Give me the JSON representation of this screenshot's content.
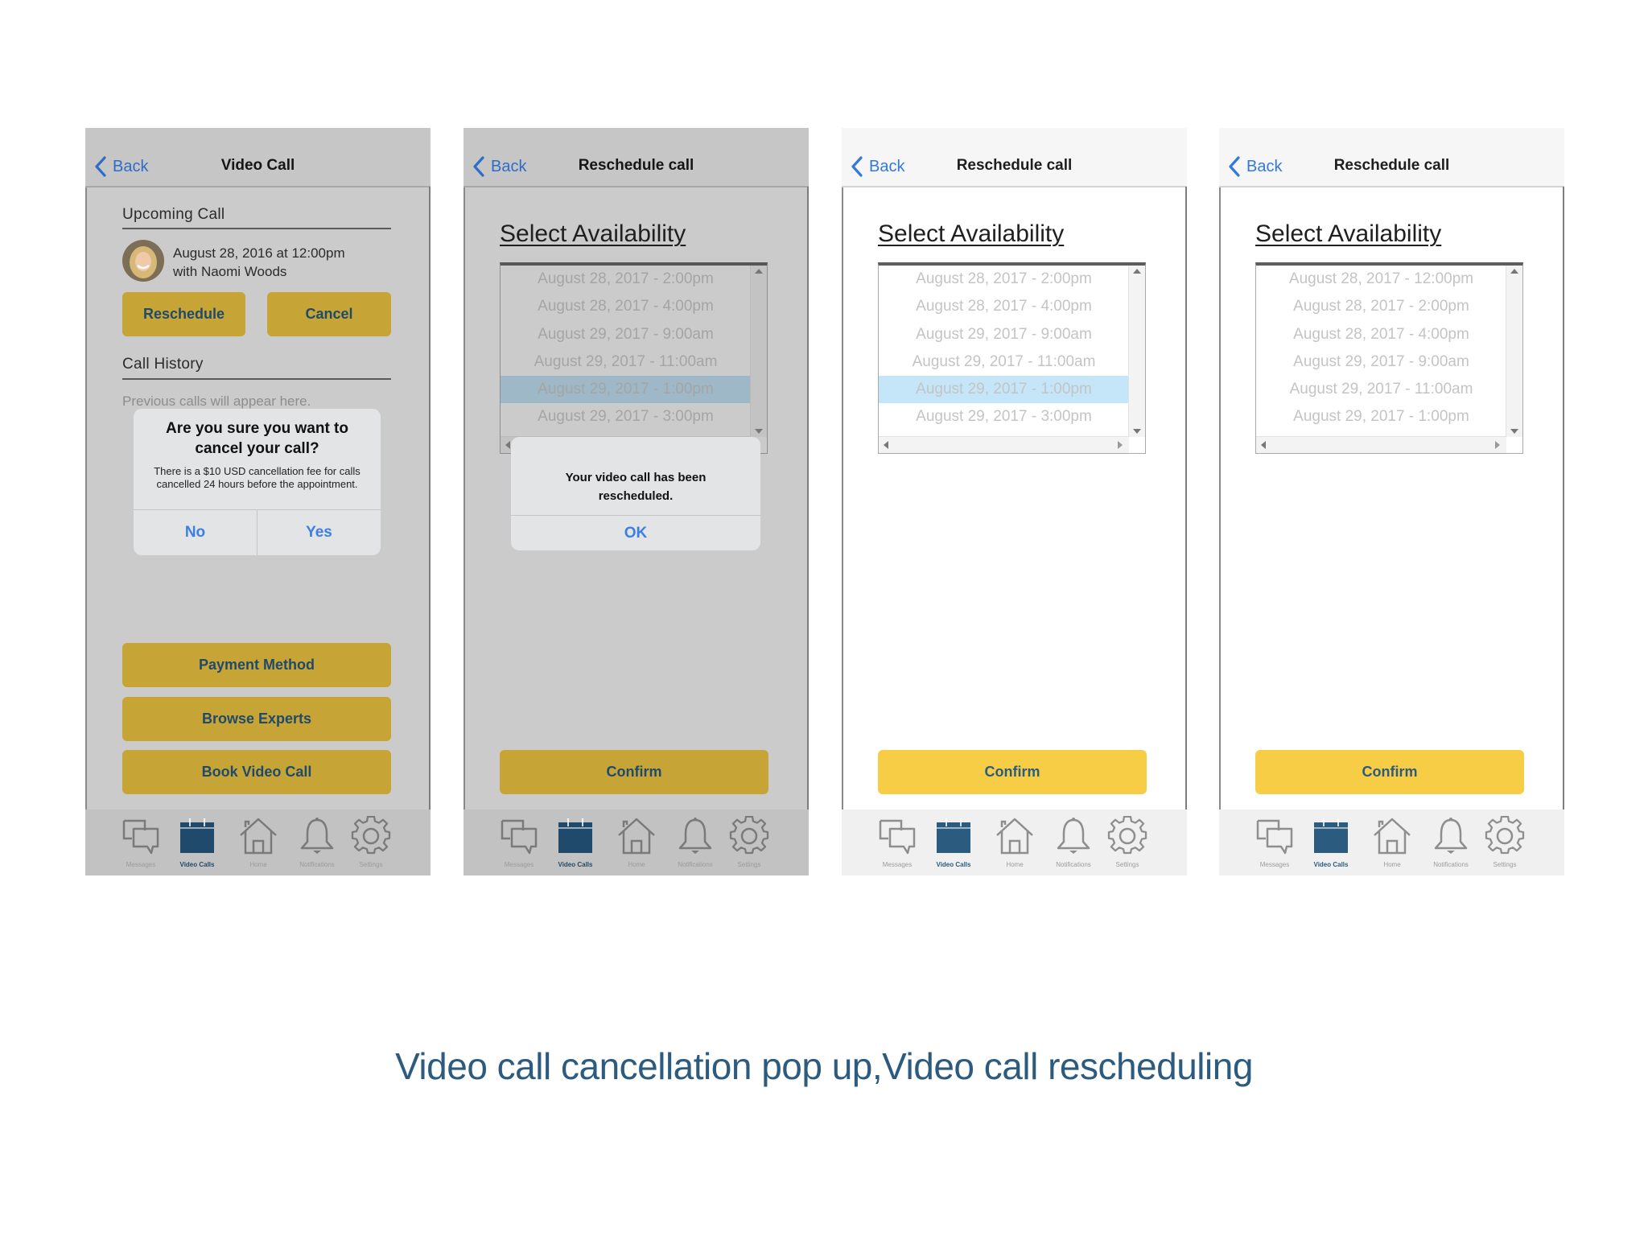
{
  "caption": "Video call cancellation pop up,Video call rescheduling",
  "colors": {
    "accent_blue": "#3478DC",
    "gold_button": "#F6CD44",
    "gold_button_dimmed": "#C7A436",
    "button_text": "#2B5B7E",
    "selected_row": "#C5E5F8",
    "caption": "#2D5B80"
  },
  "tabs": [
    {
      "label": "Messages",
      "icon": "messages-icon"
    },
    {
      "label": "Video Calls",
      "icon": "calendar-icon",
      "active": true
    },
    {
      "label": "Home",
      "icon": "home-icon"
    },
    {
      "label": "Notifications",
      "icon": "bell-icon"
    },
    {
      "label": "Settings",
      "icon": "gear-icon"
    }
  ],
  "screens": [
    {
      "id": "video-call",
      "dimmed": true,
      "back_label": "Back",
      "title": "Video Call",
      "upcoming_heading": "Upcoming Call",
      "upcoming_date": "August 28, 2016 at 12:00pm",
      "upcoming_with": "with Naomi Woods",
      "reschedule_label": "Reschedule",
      "cancel_label": "Cancel",
      "history_heading": "Call History",
      "history_empty": "Previous calls will appear here.",
      "payment_label": "Payment Method",
      "browse_label": "Browse Experts",
      "book_label": "Book Video Call",
      "alert": {
        "title": "Are you sure you want to cancel your call?",
        "message": "There is a $10 USD cancellation fee for calls cancelled 24 hours before the appointment.",
        "no_label": "No",
        "yes_label": "Yes"
      }
    },
    {
      "id": "reschedule-dimmed",
      "dimmed": true,
      "back_label": "Back",
      "title": "Reschedule call",
      "select_heading": "Select Availability",
      "slots": [
        "August 28, 2017 - 2:00pm",
        "August 28, 2017 - 4:00pm",
        "August 29, 2017 - 9:00am",
        "August 29, 2017 - 11:00am",
        "August 29, 2017 - 1:00pm",
        "August 29, 2017 - 3:00pm"
      ],
      "selected_index": 4,
      "confirm_label": "Confirm",
      "alert": {
        "message": "Your video call has been rescheduled.",
        "ok_label": "OK"
      }
    },
    {
      "id": "reschedule-selected",
      "dimmed": false,
      "back_label": "Back",
      "title": "Reschedule call",
      "select_heading": "Select Availability",
      "slots": [
        "August 28, 2017 - 2:00pm",
        "August 28, 2017 - 4:00pm",
        "August 29, 2017 - 9:00am",
        "August 29, 2017 - 11:00am",
        "August 29, 2017 - 1:00pm",
        "August 29, 2017 - 3:00pm"
      ],
      "selected_index": 4,
      "confirm_label": "Confirm"
    },
    {
      "id": "reschedule-initial",
      "dimmed": false,
      "back_label": "Back",
      "title": "Reschedule call",
      "select_heading": "Select Availability",
      "slots": [
        "August 28, 2017 - 12:00pm",
        "August 28, 2017 - 2:00pm",
        "August 28, 2017 - 4:00pm",
        "August 29, 2017 - 9:00am",
        "August 29, 2017 - 11:00am",
        "August 29, 2017 - 1:00pm"
      ],
      "selected_index": null,
      "confirm_label": "Confirm"
    }
  ]
}
